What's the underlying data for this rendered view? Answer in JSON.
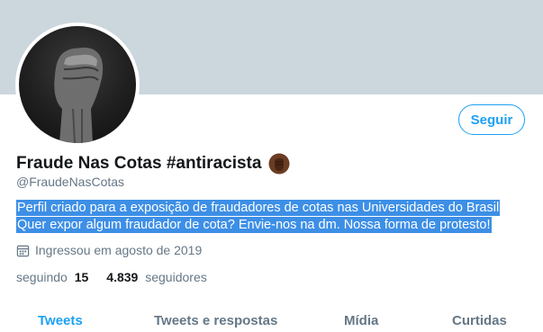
{
  "profile": {
    "display_name": "Fraude Nas Cotas #antiracista",
    "handle": "@FraudeNasCotas",
    "emoji_icon": "raised-fist-dark-emoji",
    "follow_label": "Seguir",
    "bio_lines": [
      "Perfil criado para a exposição de fraudadores de cotas nas Universidades do Brasil",
      "Quer expor algum fraudador de cota? Envie-nos na dm. Nossa forma de protesto!"
    ],
    "joined": "Ingressou em agosto de 2019",
    "following_label": "seguindo",
    "following_count": "15",
    "followers_count": "4.839",
    "followers_label": "seguidores"
  },
  "tabs": [
    "Tweets",
    "Tweets e respostas",
    "Mídia",
    "Curtidas"
  ],
  "colors": {
    "accent": "#1da1f2",
    "banner": "#ccd6dd",
    "selection": "#3d8fe6"
  }
}
